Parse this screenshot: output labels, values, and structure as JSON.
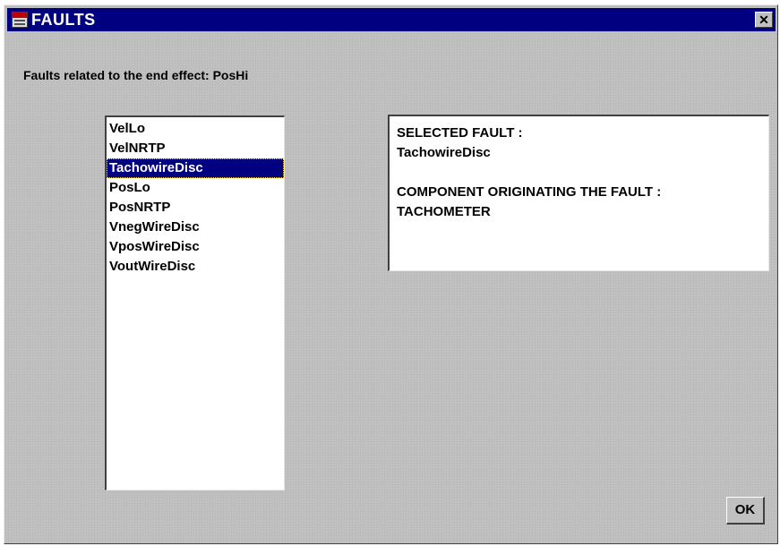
{
  "window": {
    "title": "FAULTS",
    "close_label": "✕"
  },
  "heading": "Faults related to the end effect: PosHi",
  "fault_list": {
    "items": [
      "VelLo",
      "VelNRTP",
      "TachowireDisc",
      "PosLo",
      "PosNRTP",
      "VnegWireDisc",
      "VposWireDisc",
      "VoutWireDisc"
    ],
    "selected": "TachowireDisc"
  },
  "details": {
    "selected_fault_label": "SELECTED FAULT :",
    "selected_fault_value": "TachowireDisc",
    "component_label": "COMPONENT ORIGINATING THE FAULT :",
    "component_value": "TACHOMETER"
  },
  "ok_label": "OK",
  "colors": {
    "title_bar": "#000080",
    "window_bg": "#c0c0c0",
    "selection": "#000080"
  }
}
